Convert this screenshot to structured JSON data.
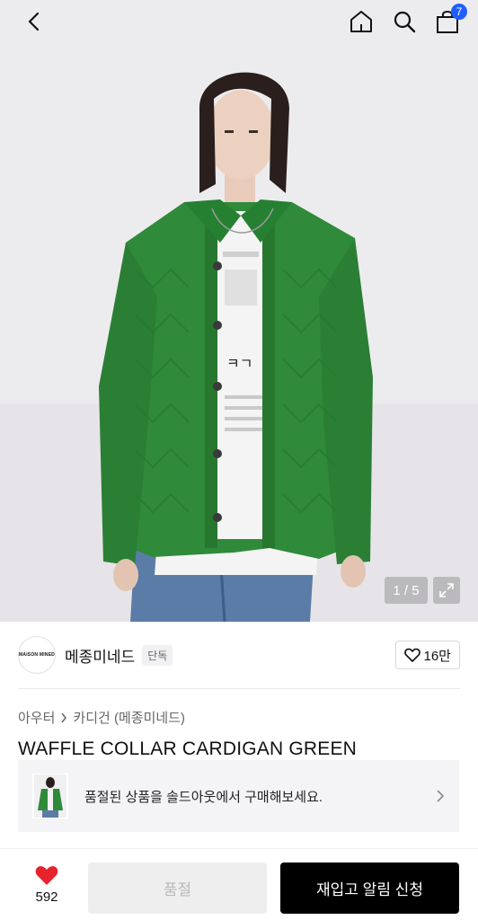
{
  "header": {
    "back_icon": "chevron-left-icon",
    "home_icon": "home-icon",
    "search_icon": "search-icon",
    "cart_icon": "shopping-bag-icon",
    "cart_count": "7"
  },
  "gallery": {
    "counter": "1 / 5",
    "expand_icon": "expand-icon"
  },
  "brand": {
    "logo_text": "MAISON MINED",
    "name": "메종미네드",
    "tag": "단독",
    "likes": "16만"
  },
  "breadcrumb": {
    "category": "아우터",
    "subcategory": "카디건 (메종미네드)"
  },
  "product": {
    "title": "WAFFLE COLLAR CARDIGAN GREEN"
  },
  "soldout_banner": {
    "text": "품절된 상품을 솔드아웃에서 구매해보세요."
  },
  "bottom_bar": {
    "wish_count": "592",
    "soldout_label": "품절",
    "restock_label": "재입고 알림 신청"
  },
  "colors": {
    "accent_badge": "#1e5eff",
    "heart": "#e8222d",
    "cardigan_green": "#2f8a3a"
  }
}
